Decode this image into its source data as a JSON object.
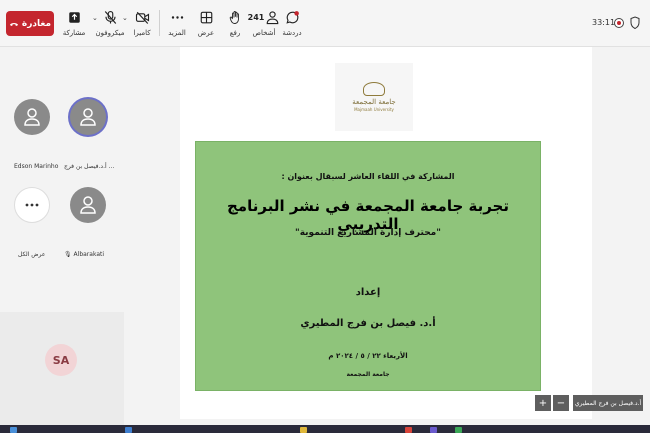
{
  "toolbar": {
    "leave_label": "مغادرة",
    "share_label": "مشاركة",
    "mic_label": "ميكروفون",
    "camera_label": "كاميرا",
    "more_label": "المزيد",
    "view_label": "عرض",
    "raise_label": "رفع",
    "people_label": "أشخاص",
    "people_count": "241",
    "chat_label": "دردشة",
    "timer": "33:11",
    "leave_color": "#c4262e"
  },
  "participants": [
    {
      "name": "أ.د.فيصل بن فرج ..."
    },
    {
      "name": "Edson Marinho"
    },
    {
      "name": "Albarakati"
    },
    {
      "name": "عرض الكل"
    }
  ],
  "self_avatar": {
    "initials": "SA"
  },
  "slide": {
    "logo_name": "جامعة المجمعة",
    "logo_sub": "Majmaah University",
    "line1": "المشاركة في اللقاء العاشر لسبقال بعنوان :",
    "line2": "تجربة جامعة المجمعة في نشر البرنامج التدريبي",
    "line3": "\"محترف إدارة المشاريع التنموية\"",
    "line4": "إعداد",
    "line5": "أ.د. فيصل بن فرج المطيري",
    "line6": "الأربعاء ٢٢ / ٥ / ٢٠٢٤ م",
    "line7": "جامعة المجمعة",
    "bg_color": "#8fc47b"
  },
  "presenter_tag": "أ.د.فيصل بن فرج المطيري",
  "zoom": {
    "plus": "+",
    "minus": "−"
  }
}
